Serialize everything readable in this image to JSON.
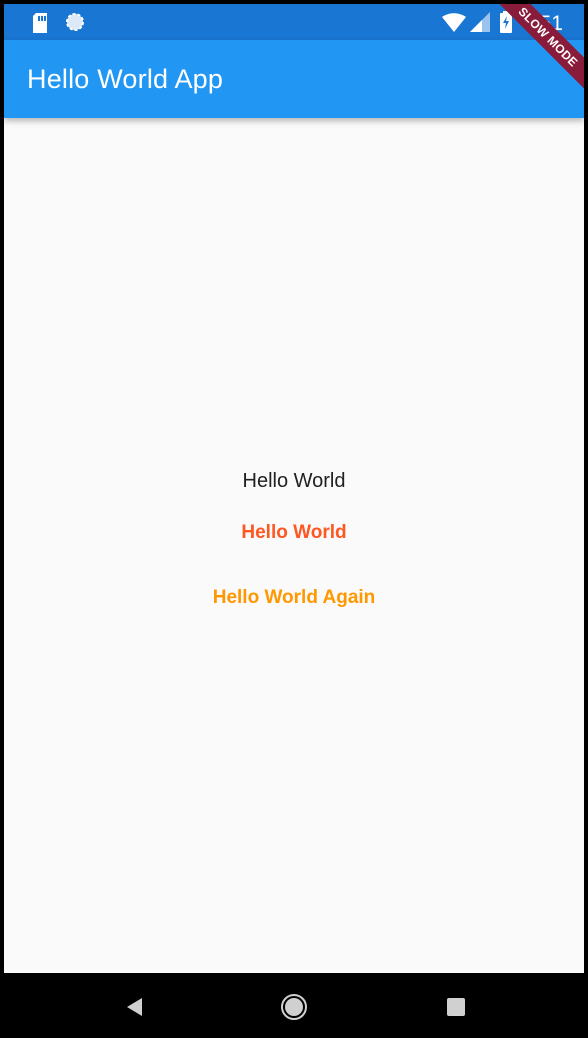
{
  "status_bar": {
    "time": "7:51",
    "background": "#1976d2",
    "icons": [
      "sd-card-icon",
      "sync-icon",
      "wifi-icon",
      "signal-icon",
      "battery-charging-icon"
    ]
  },
  "app_bar": {
    "title": "Hello World App",
    "background": "#2196f3"
  },
  "debug_banner": {
    "label": "SLOW MODE",
    "color": "#8a1c3b"
  },
  "body": {
    "background": "#fafafa",
    "texts": [
      {
        "label": "Hello World",
        "color": "#212121"
      },
      {
        "label": "Hello World",
        "color": "#ff5722"
      },
      {
        "label": "Hello World Again",
        "color": "#ff9800"
      }
    ]
  },
  "nav_bar": {
    "icons": [
      "back-icon",
      "home-icon",
      "recents-icon"
    ]
  }
}
